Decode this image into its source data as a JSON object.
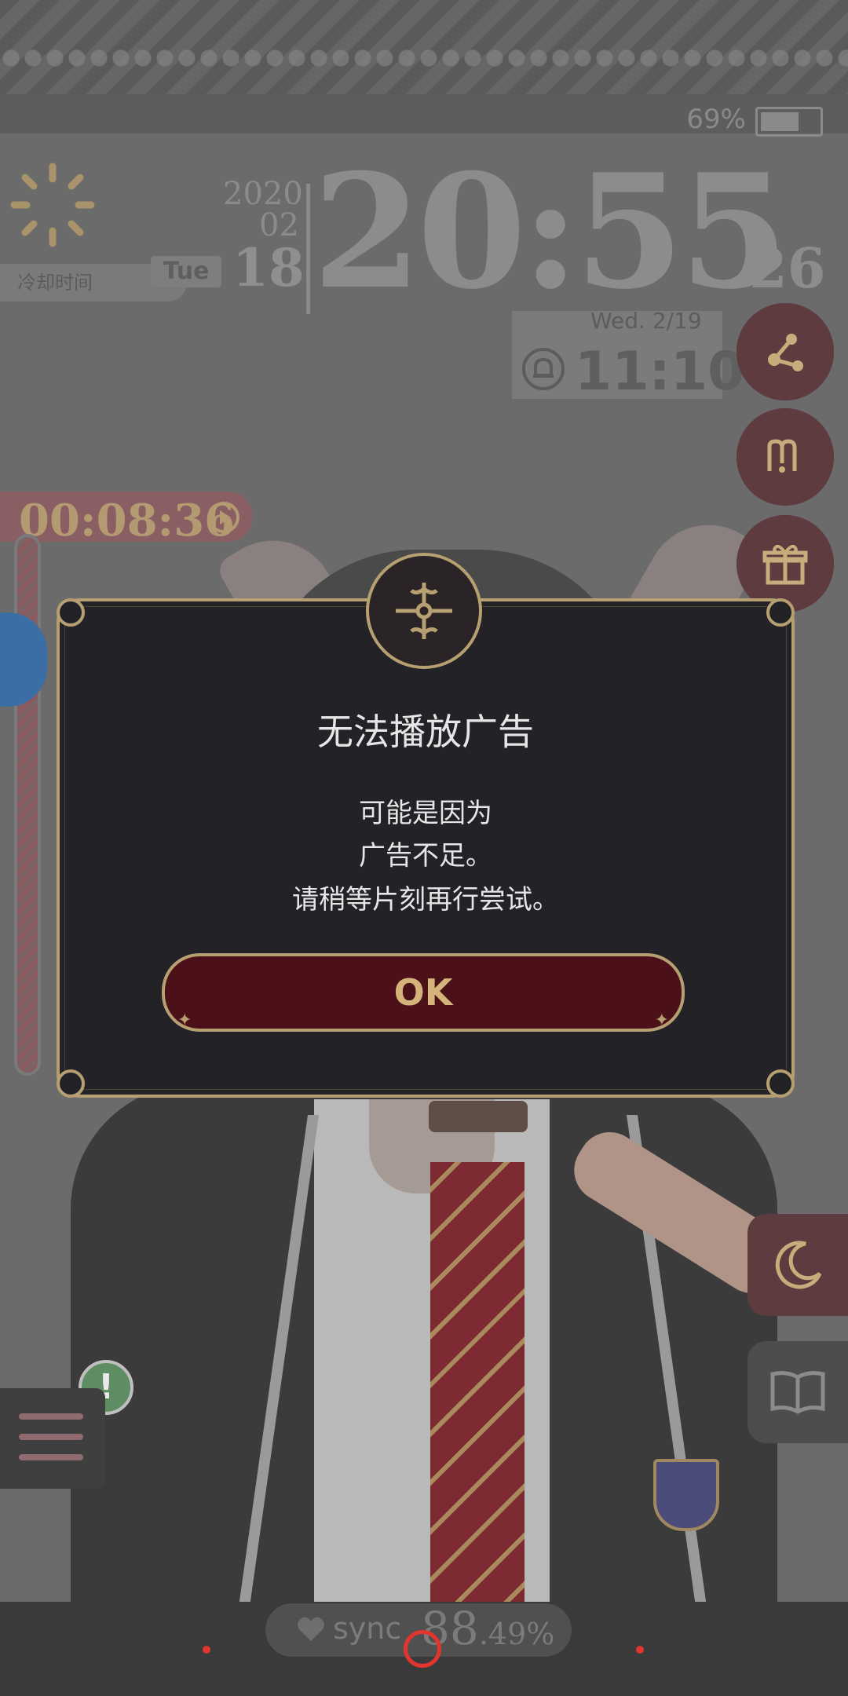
{
  "status": {
    "battery_percent": "69%",
    "battery_level": 0.69
  },
  "lock": {
    "cooldown_label": "冷却时间",
    "date_year": "2020",
    "date_month": "02",
    "date_day": "18",
    "day_of_week": "Tue",
    "time": "20:55",
    "seconds": "26",
    "alarm_date": "Wed.   2/19",
    "alarm_time": "11:10"
  },
  "timer": {
    "value": "00:08:36"
  },
  "side_buttons": [
    {
      "icon": "share-icon"
    },
    {
      "icon": "m-icon"
    },
    {
      "icon": "gift-icon"
    }
  ],
  "lower_tabs": [
    {
      "icon": "moon-icon"
    },
    {
      "icon": "book-icon"
    }
  ],
  "alert": {
    "symbol": "!"
  },
  "sync": {
    "label": "sync",
    "value_int": "88",
    "value_dec": ".49%"
  },
  "dialog": {
    "title": "无法播放广告",
    "message_lines": [
      "可能是因为",
      "广告不足。",
      "请稍等片刻再行尝试。"
    ],
    "ok_label": "OK"
  },
  "colors": {
    "gold": "#b6a071",
    "dialog_bg": "#232227",
    "ok_bg": "#4c1118",
    "ok_text": "#d4b47a",
    "accent_red": "#e2352f"
  }
}
